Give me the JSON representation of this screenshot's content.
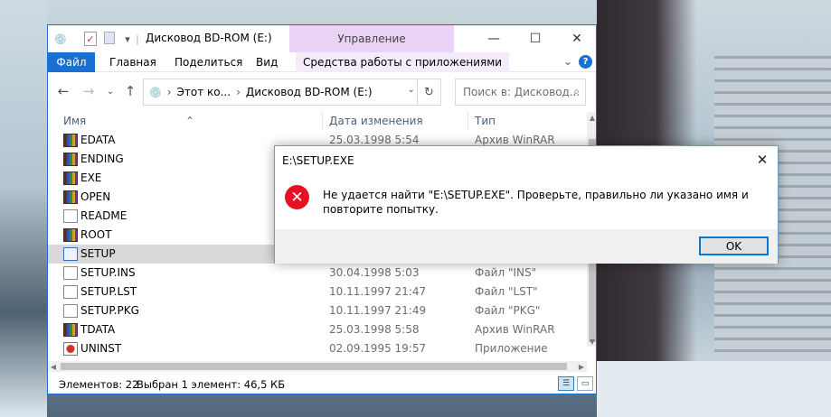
{
  "window": {
    "title": "Дисковод BD-ROM (E:)",
    "context_tab": "Управление",
    "controls": [
      "minimize",
      "maximize",
      "close"
    ]
  },
  "ribbon": {
    "tabs": [
      "Файл",
      "Главная",
      "Поделиться",
      "Вид",
      "Средства работы с приложениями"
    ],
    "help": "?"
  },
  "address": {
    "segments": [
      "Этот ко...",
      "Дисковод BD-ROM (E:)"
    ],
    "search_placeholder": "Поиск в: Дисковод..."
  },
  "columns": {
    "name": "Имя",
    "date": "Дата изменения",
    "type": "Тип"
  },
  "files": [
    {
      "name": "EDATA",
      "date": "25.03.1998 5:54",
      "type": "Архив WinRAR",
      "icon": "winrar-icon"
    },
    {
      "name": "ENDING",
      "date": "",
      "type": "",
      "icon": "winrar-icon"
    },
    {
      "name": "EXE",
      "date": "",
      "type": "",
      "icon": "winrar-icon"
    },
    {
      "name": "OPEN",
      "date": "",
      "type": "",
      "icon": "winrar-icon"
    },
    {
      "name": "README",
      "date": "",
      "type": "",
      "icon": "text-document-icon"
    },
    {
      "name": "ROOT",
      "date": "",
      "type": "",
      "icon": "winrar-icon"
    },
    {
      "name": "SETUP",
      "date": "",
      "type": "",
      "icon": "setup-app-icon"
    },
    {
      "name": "SETUP.INS",
      "date": "30.04.1998 5:03",
      "type": "Файл \"INS\"",
      "icon": "blank-file-icon"
    },
    {
      "name": "SETUP.LST",
      "date": "10.11.1997 21:47",
      "type": "Файл \"LST\"",
      "icon": "blank-file-icon"
    },
    {
      "name": "SETUP.PKG",
      "date": "10.11.1997 21:49",
      "type": "Файл \"PKG\"",
      "icon": "blank-file-icon"
    },
    {
      "name": "TDATA",
      "date": "25.03.1998 5:58",
      "type": "Архив WinRAR",
      "icon": "winrar-icon"
    },
    {
      "name": "UNINST",
      "date": "02.09.1995 19:57",
      "type": "Приложение",
      "icon": "uninstall-app-icon"
    }
  ],
  "status": {
    "count": "Элементов: 22",
    "selection": "Выбран 1 элемент: 46,5 КБ"
  },
  "dialog": {
    "title": "E:\\SETUP.EXE",
    "message": "Не удается найти \"E:\\SETUP.EXE\". Проверьте, правильно ли указано имя и повторите попытку.",
    "ok_label": "OK"
  },
  "colors": {
    "accent": "#1a6fd0",
    "manage_tab": "#e9d3f6",
    "error": "#e81123"
  }
}
